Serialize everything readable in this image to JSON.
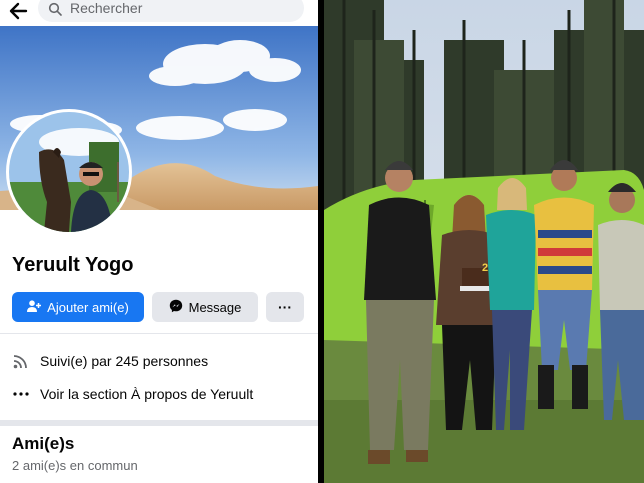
{
  "search": {
    "placeholder": "Rechercher"
  },
  "profile": {
    "name": "Yeruult Yogo",
    "actions": {
      "add_friend": "Ajouter ami(e)",
      "message": "Message",
      "more": "···"
    },
    "followers": "Suivi(e) par 245 personnes",
    "about": "Voir la section À propos de Yeruult",
    "friends_section": {
      "title": "Ami(e)s",
      "subtitle": "2 ami(e)s en commun"
    }
  },
  "photo": {
    "cake_text": "27"
  },
  "colors": {
    "primary_button": "#1877f2",
    "secondary_button": "#e4e6eb",
    "text": "#050505",
    "muted_text": "#65676b"
  },
  "icons": [
    "back-arrow-icon",
    "search-icon",
    "add-friend-icon",
    "messenger-icon",
    "more-icon",
    "rss-icon",
    "dots-icon"
  ]
}
